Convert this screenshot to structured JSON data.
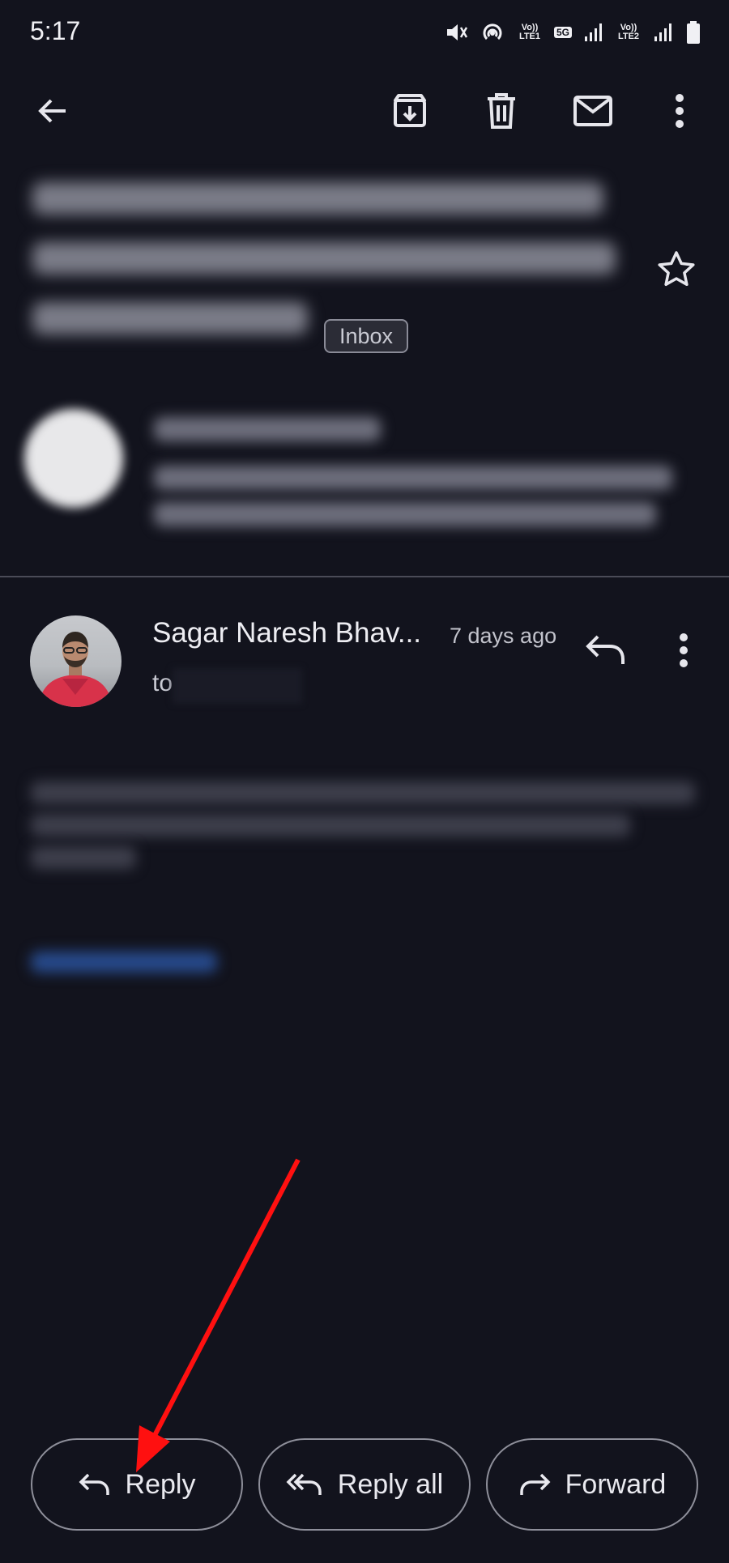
{
  "status_bar": {
    "time": "5:17",
    "icons": [
      "mute-icon",
      "hotspot-icon",
      "volte-lte1-icon",
      "5g-icon",
      "signal-icon",
      "volte-lte2-icon",
      "signal-icon",
      "battery-icon"
    ],
    "lte1": "Vo)) LTE1",
    "network": "5G",
    "lte2": "Vo)) LTE2"
  },
  "toolbar": {
    "icons": [
      "back-arrow-icon",
      "archive-icon",
      "trash-icon",
      "mail-icon",
      "more-vert-icon"
    ]
  },
  "subject": {
    "label_chip": "Inbox"
  },
  "message": {
    "sender_name": "Sagar Naresh Bhav...",
    "time": "7 days ago",
    "to_prefix": "to"
  },
  "actions": {
    "reply": "Reply",
    "reply_all": "Reply all",
    "forward": "Forward"
  },
  "colors": {
    "background": "#12131d",
    "annotation_arrow": "#ff1010"
  }
}
